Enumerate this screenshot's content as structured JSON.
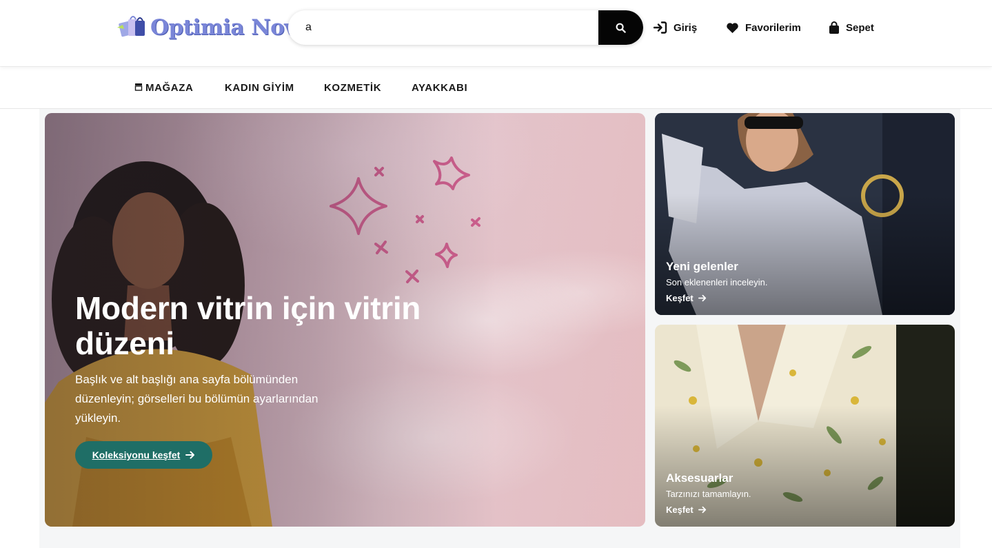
{
  "brand": {
    "name": "Optimia Nova",
    "text_color": "#7a86d8"
  },
  "search": {
    "value": "a",
    "placeholder": "",
    "button_icon": "search-icon"
  },
  "header_links": [
    {
      "label": "Giriş",
      "icon": "login-icon"
    },
    {
      "label": "Favorilerim",
      "icon": "heart-icon"
    },
    {
      "label": "Sepet",
      "icon": "shopping-bag-icon"
    }
  ],
  "nav": {
    "items": [
      {
        "label": "MAĞAZA",
        "icon": "store-icon"
      },
      {
        "label": "KADIN GİYİM"
      },
      {
        "label": "KOZMETİK"
      },
      {
        "label": "AYAKKABI"
      }
    ]
  },
  "hero": {
    "title": "Modern vitrin için vitrin düzeni",
    "subtitle": "Başlık ve alt başlığı ana sayfa bölümünden düzenleyin; görselleri bu bölümün ayarlarından yükleyin.",
    "cta_label": "Koleksiyonu keşfet",
    "cta_color": "#1f6e66"
  },
  "cards": [
    {
      "title": "Yeni gelenler",
      "subtitle": "Son eklenenleri inceleyin.",
      "link": "Keşfet"
    },
    {
      "title": "Aksesuarlar",
      "subtitle": "Tarzınızı tamamlayın.",
      "link": "Keşfet"
    }
  ]
}
